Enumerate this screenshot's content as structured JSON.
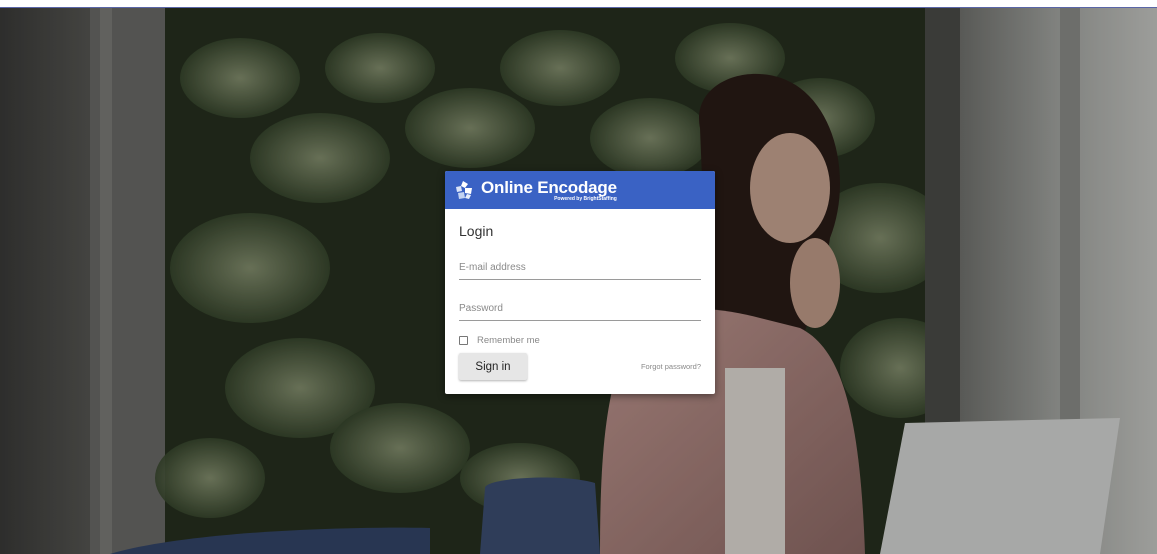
{
  "brand": {
    "name": "Online Encodage",
    "subtitle": "Powered by BrightStaffing",
    "icon": "puzzle-logo-icon",
    "header_color": "#3a62c4"
  },
  "login": {
    "title": "Login",
    "email_placeholder": "E-mail address",
    "email_value": "",
    "password_placeholder": "Password",
    "password_value": "",
    "remember_label": "Remember me",
    "remember_checked": false,
    "signin_label": "Sign in",
    "forgot_label": "Forgot password?"
  },
  "background": {
    "description_icon": "office-photo-background",
    "dominant_colors": [
      "#2f3a2a",
      "#5b6654",
      "#cfcfca",
      "#b48a84"
    ]
  }
}
